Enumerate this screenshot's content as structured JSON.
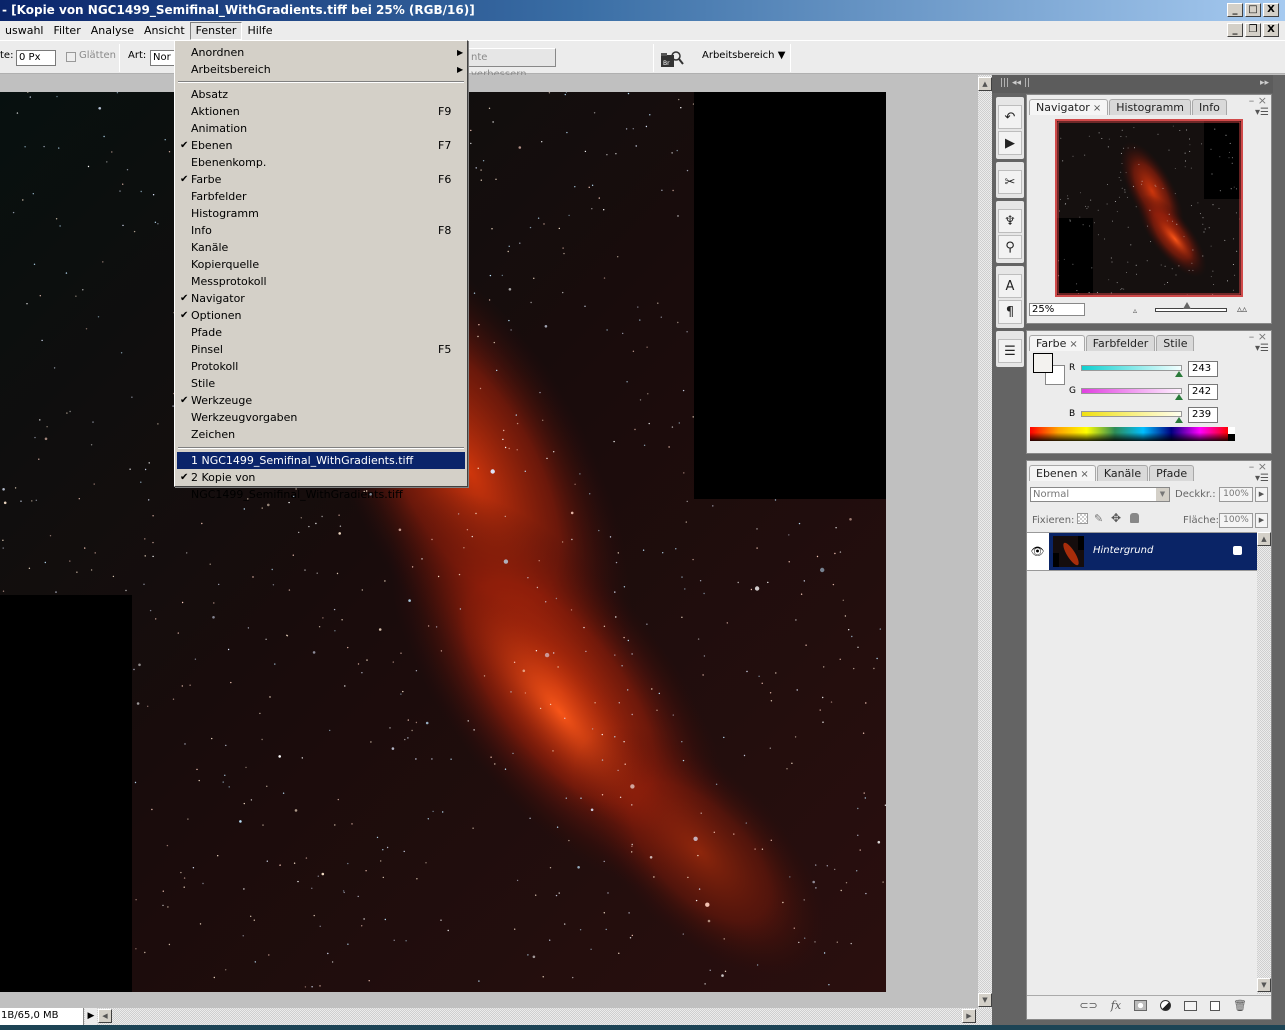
{
  "window": {
    "title": "- [Kopie von NGC1499_Semifinal_WithGradients.tiff bei 25% (RGB/16)]",
    "controls": [
      "_",
      "□",
      "X"
    ],
    "doc_controls": [
      "_",
      "❐",
      "X"
    ]
  },
  "menubar": {
    "items": [
      "uswahl",
      "Filter",
      "Analyse",
      "Ansicht",
      "Fenster",
      "Hilfe"
    ],
    "open": "Fenster"
  },
  "options": {
    "feather_label": "te:",
    "feather_value": "0 Px",
    "antialias_label": "Glätten",
    "style_label": "Art:",
    "style_value": "Nor",
    "refine_button": "nte verbessern...",
    "workspace_label": "Arbeitsbereich ▼",
    "bridge_icon": "Br"
  },
  "fenster_menu": {
    "submenus": [
      {
        "label": "Anordnen"
      },
      {
        "label": "Arbeitsbereich"
      }
    ],
    "items": [
      {
        "label": "Absatz",
        "checked": false,
        "key": ""
      },
      {
        "label": "Aktionen",
        "checked": false,
        "key": "F9"
      },
      {
        "label": "Animation",
        "checked": false,
        "key": ""
      },
      {
        "label": "Ebenen",
        "checked": true,
        "key": "F7"
      },
      {
        "label": "Ebenenkomp.",
        "checked": false,
        "key": ""
      },
      {
        "label": "Farbe",
        "checked": true,
        "key": "F6"
      },
      {
        "label": "Farbfelder",
        "checked": false,
        "key": ""
      },
      {
        "label": "Histogramm",
        "checked": false,
        "key": ""
      },
      {
        "label": "Info",
        "checked": false,
        "key": "F8"
      },
      {
        "label": "Kanäle",
        "checked": false,
        "key": ""
      },
      {
        "label": "Kopierquelle",
        "checked": false,
        "key": ""
      },
      {
        "label": "Messprotokoll",
        "checked": false,
        "key": ""
      },
      {
        "label": "Navigator",
        "checked": true,
        "key": ""
      },
      {
        "label": "Optionen",
        "checked": true,
        "key": ""
      },
      {
        "label": "Pfade",
        "checked": false,
        "key": ""
      },
      {
        "label": "Pinsel",
        "checked": false,
        "key": "F5"
      },
      {
        "label": "Protokoll",
        "checked": false,
        "key": ""
      },
      {
        "label": "Stile",
        "checked": false,
        "key": ""
      },
      {
        "label": "Werkzeuge",
        "checked": true,
        "key": ""
      },
      {
        "label": "Werkzeugvorgaben",
        "checked": false,
        "key": ""
      },
      {
        "label": "Zeichen",
        "checked": false,
        "key": ""
      }
    ],
    "documents": [
      {
        "label": "1 NGC1499_Semifinal_WithGradients.tiff",
        "checked": false,
        "highlighted": true
      },
      {
        "label": "2 Kopie von NGC1499_Semifinal_WithGradients.tiff",
        "checked": true,
        "highlighted": false
      }
    ]
  },
  "status": {
    "doc_size": "1B/65,0 MB"
  },
  "navigator": {
    "tabs": [
      "Navigator",
      "Histogramm",
      "Info"
    ],
    "zoom": "25%",
    "zoom_slider": 0.45
  },
  "color": {
    "tabs": [
      "Farbe",
      "Farbfelder",
      "Stile"
    ],
    "channels": [
      {
        "label": "R",
        "value": "243"
      },
      {
        "label": "G",
        "value": "242"
      },
      {
        "label": "B",
        "value": "239"
      }
    ],
    "fg_color": "#f3f2ef",
    "bg_color": "#ffffff"
  },
  "layers": {
    "tabs": [
      "Ebenen",
      "Kanäle",
      "Pfade"
    ],
    "blend_mode": "Normal",
    "opacity_label": "Deckkr.:",
    "opacity": "100%",
    "lock_label": "Fixieren:",
    "fill_label": "Fläche:",
    "fill": "100%",
    "items": [
      {
        "name": "Hintergrund",
        "visible": true,
        "locked": true,
        "selected": true
      }
    ],
    "footer_icons": [
      "link-icon",
      "fx-icon",
      "mask-icon",
      "adjustment-icon",
      "folder-icon",
      "new-layer-icon",
      "trash-icon"
    ]
  },
  "colors": {
    "accent": "#0a246a",
    "nebula": "#c8280a",
    "panel_bg": "#ececec"
  }
}
